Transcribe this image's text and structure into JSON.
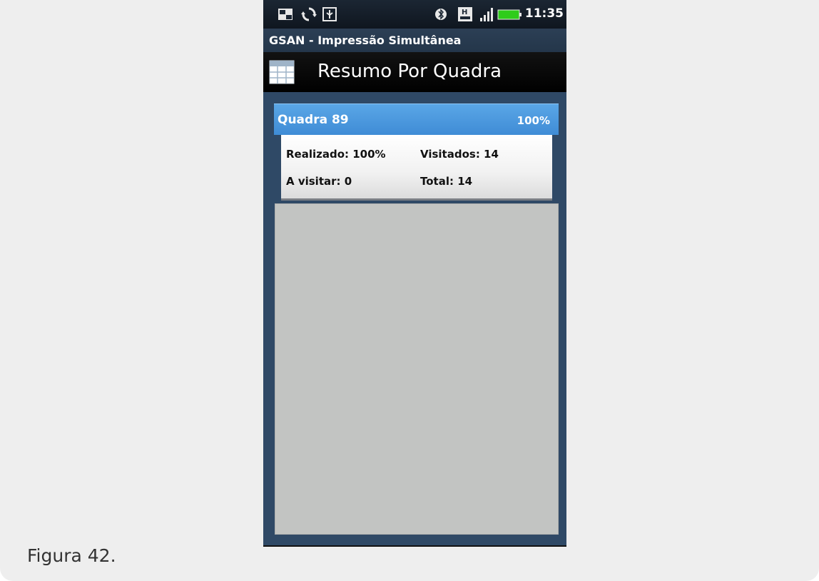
{
  "status_bar": {
    "time": "11:35",
    "icons": [
      "picture-icon",
      "sync-icon",
      "usb-icon",
      "bluetooth-icon",
      "h-network-icon",
      "signal-icon",
      "battery-icon"
    ],
    "battery_color": "#2ecc1a"
  },
  "app": {
    "title": "GSAN - Impressão Simultânea"
  },
  "screen": {
    "title": "Resumo Por Quadra"
  },
  "block": {
    "name": "Quadra 89",
    "percent": "100%",
    "realizado": "Realizado: 100%",
    "visitados": "Visitados: 14",
    "a_visitar": "A visitar: 0",
    "total": "Total: 14",
    "header_color": "#4a97dd"
  },
  "caption": "Figura 42."
}
